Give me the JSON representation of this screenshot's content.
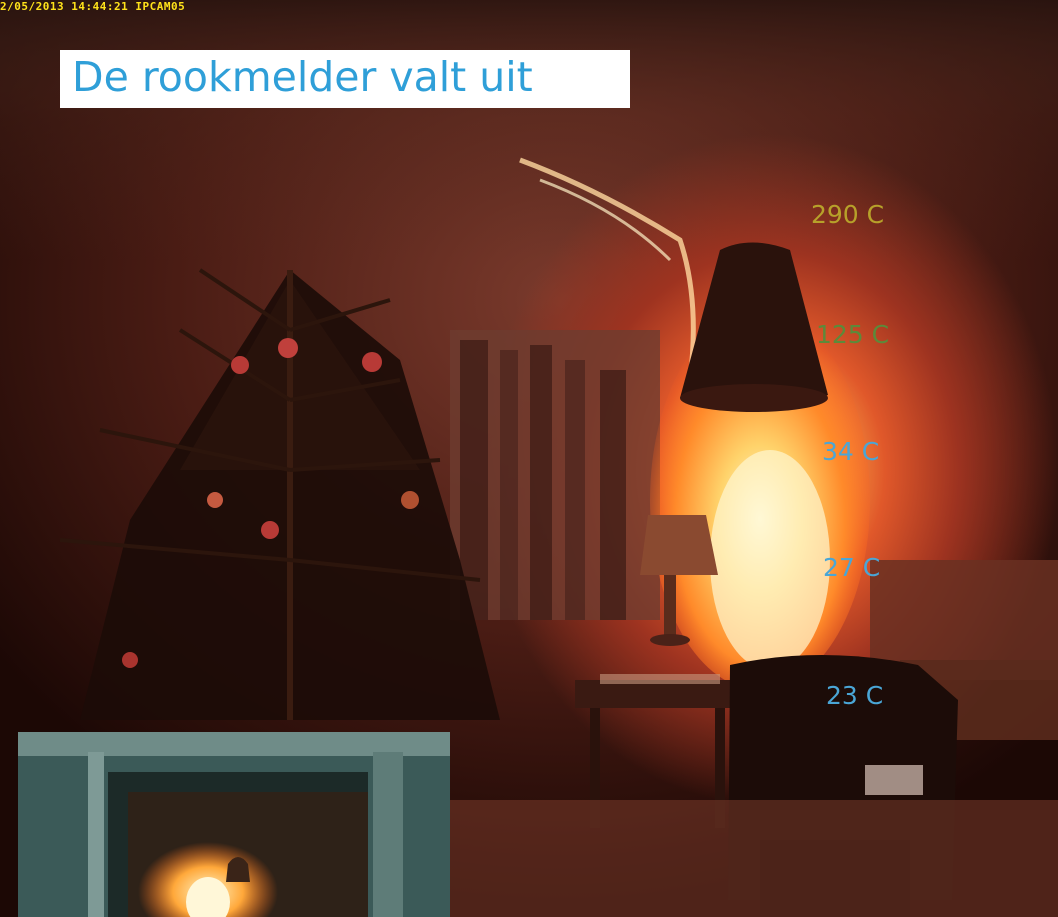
{
  "overlay": {
    "timestamp": "2/05/2013 14:44:21 IPCAM05",
    "title": "De rookmelder valt uit"
  },
  "temperatures": [
    "290 C",
    "125 C",
    "34 C",
    "27 C",
    "23 C"
  ],
  "colors": {
    "title_text": "#2f9fd8",
    "title_background": "#ffffff",
    "timestamp_text": "#ffe21a",
    "temp_290": "#b7a12a",
    "temp_125": "#5c8a3a",
    "temp_low": "#4aa6d6",
    "fire": "#ffb24a"
  },
  "scene": {
    "objects": [
      "christmas-tree",
      "window-curtains",
      "hanging-lamp-shade",
      "fire",
      "table-lamp",
      "coffee-table",
      "crt-television",
      "sofa",
      "rug",
      "inset-camera-view"
    ]
  }
}
